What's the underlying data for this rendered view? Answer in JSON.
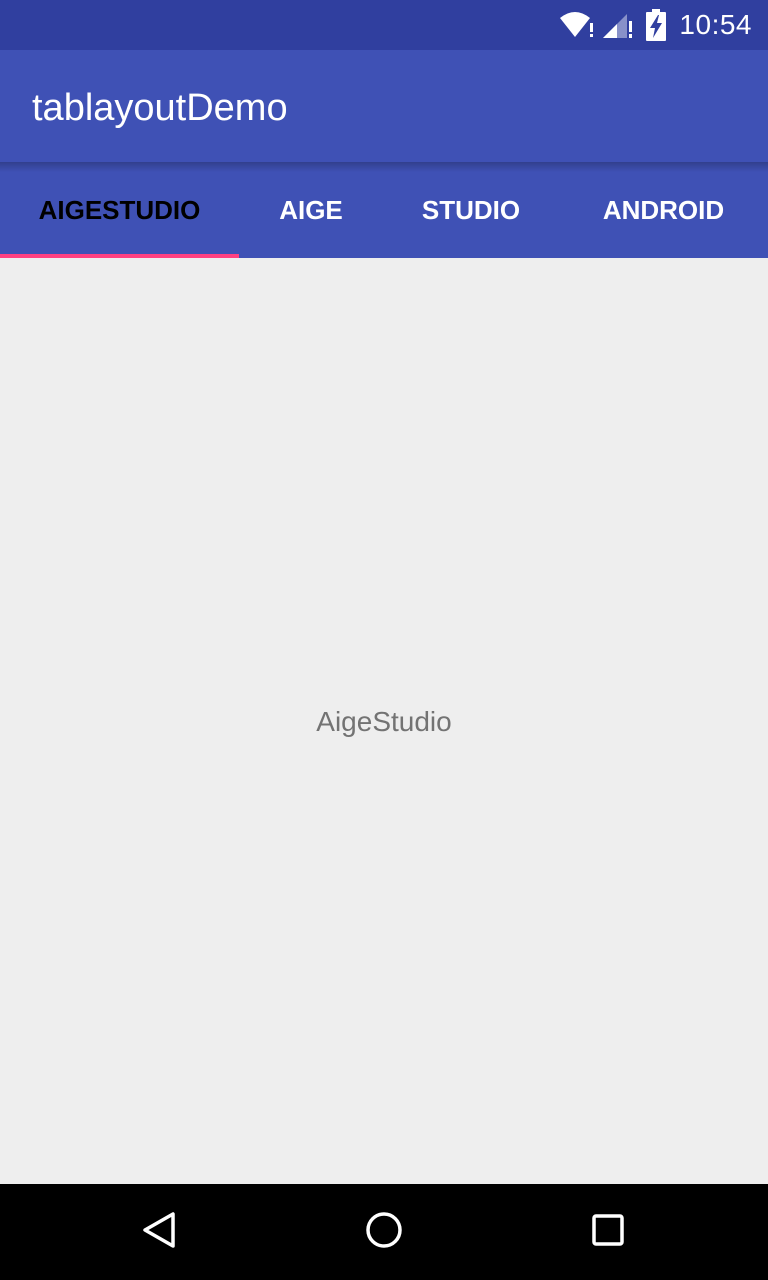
{
  "status_bar": {
    "time": "10:54",
    "icons": [
      "wifi-alert-icon",
      "signal-alert-icon",
      "battery-charging-icon"
    ],
    "background": "#303f9f"
  },
  "app_bar": {
    "title": "tablayoutDemo",
    "background": "#3f51b5"
  },
  "tabs": {
    "items": [
      {
        "label": "AIGESTUDIO",
        "selected": true
      },
      {
        "label": "AIGE",
        "selected": false
      },
      {
        "label": "STUDIO",
        "selected": false
      },
      {
        "label": "ANDROID",
        "selected": false
      }
    ],
    "indicator_color": "#ff4081",
    "selected_text_color": "#000000",
    "text_color": "#ffffff"
  },
  "content": {
    "text": "AigeStudio",
    "background": "#eeeeee"
  },
  "nav_bar": {
    "buttons": [
      "back-icon",
      "home-icon",
      "recents-icon"
    ],
    "background": "#000000"
  }
}
